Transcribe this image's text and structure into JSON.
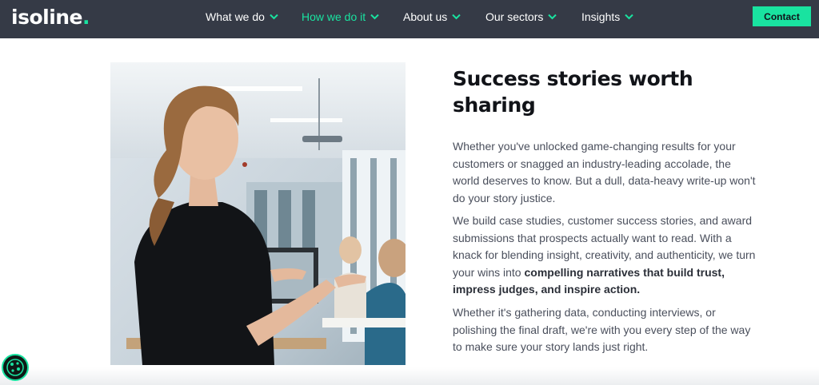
{
  "brand": {
    "logo_text": "isoline",
    "logo_dot": ".",
    "accent": "#19e3a0",
    "nav_bg": "#353a46"
  },
  "nav": {
    "items": [
      {
        "label": "What we do",
        "icon": "chevron-down-icon"
      },
      {
        "label": "How we do it",
        "icon": "chevron-down-icon",
        "active": true
      },
      {
        "label": "About us",
        "icon": "chevron-down-icon"
      },
      {
        "label": "Our sectors",
        "icon": "chevron-down-icon"
      },
      {
        "label": "Insights",
        "icon": "chevron-down-icon"
      }
    ],
    "contact_label": "Contact"
  },
  "main": {
    "heading": "Success stories  worth sharing",
    "para1": "Whether you've unlocked game-changing results for your customers or snagged an industry-leading accolade, the world deserves to know. But a dull, data-heavy write-up won't do your story justice.",
    "para2_text": "We build case studies, customer success stories, and award submissions that prospects actually want to read. With a knack for blending insight, creativity, and authenticity, we turn your wins into ",
    "para2_bold": "compelling narratives that build trust, impress judges, and inspire action.",
    "para3": "Whether it's gathering data, conducting interviews, or polishing the final draft, we're with you every step of the way to make sure your story lands just right."
  },
  "photo": {
    "subject": "woman presenting in an office meeting room",
    "icon": "photo"
  },
  "cookie": {
    "icon": "cookie-icon"
  }
}
